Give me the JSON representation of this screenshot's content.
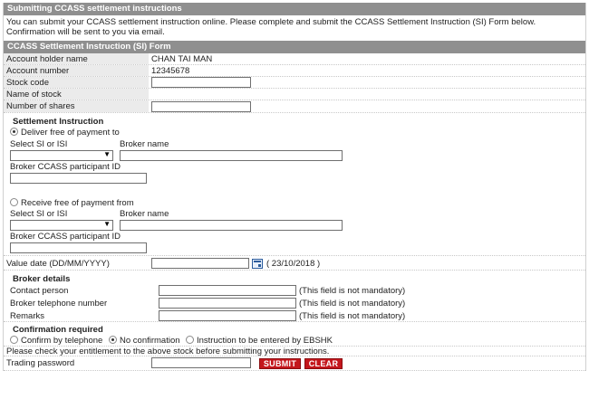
{
  "header": {
    "title": "Submitting CCASS settlement instructions",
    "intro": "You can submit your CCASS settlement instruction online. Please complete and submit the CCASS Settlement Instruction (SI) Form below. Confirmation will be sent to you via email."
  },
  "form": {
    "title": "CCASS Settlement Instruction (SI) Form",
    "account_holder_label": "Account holder name",
    "account_holder_value": "CHAN TAI MAN",
    "account_number_label": "Account number",
    "account_number_value": "12345678",
    "stock_code_label": "Stock code",
    "stock_name_label": "Name of stock",
    "shares_label": "Number of shares"
  },
  "settlement": {
    "title": "Settlement Instruction",
    "deliver_label": "Deliver free of payment to",
    "receive_label": "Receive free of payment from",
    "select_label": "Select SI or ISI",
    "broker_name_label": "Broker name",
    "participant_label": "Broker CCASS participant ID"
  },
  "value_date": {
    "label": "Value date (DD/MM/YYYY)",
    "hint": "( 23/10/2018 )"
  },
  "broker": {
    "title": "Broker details",
    "contact_label": "Contact person",
    "phone_label": "Broker telephone number",
    "remarks_label": "Remarks",
    "optional_note": "(This field is not mandatory)"
  },
  "confirmation": {
    "title": "Confirmation required",
    "options": [
      "Confirm by telephone",
      "No confirmation",
      "Instruction to be entered by EBSHK"
    ]
  },
  "footer": {
    "notice": "Please check your entitlement to the above stock before submitting your instructions.",
    "password_label": "Trading password",
    "submit_label": "SUBMIT",
    "clear_label": "CLEAR"
  },
  "colors": {
    "header_bg": "#8f8f8f",
    "button_red": "#c4161c"
  }
}
